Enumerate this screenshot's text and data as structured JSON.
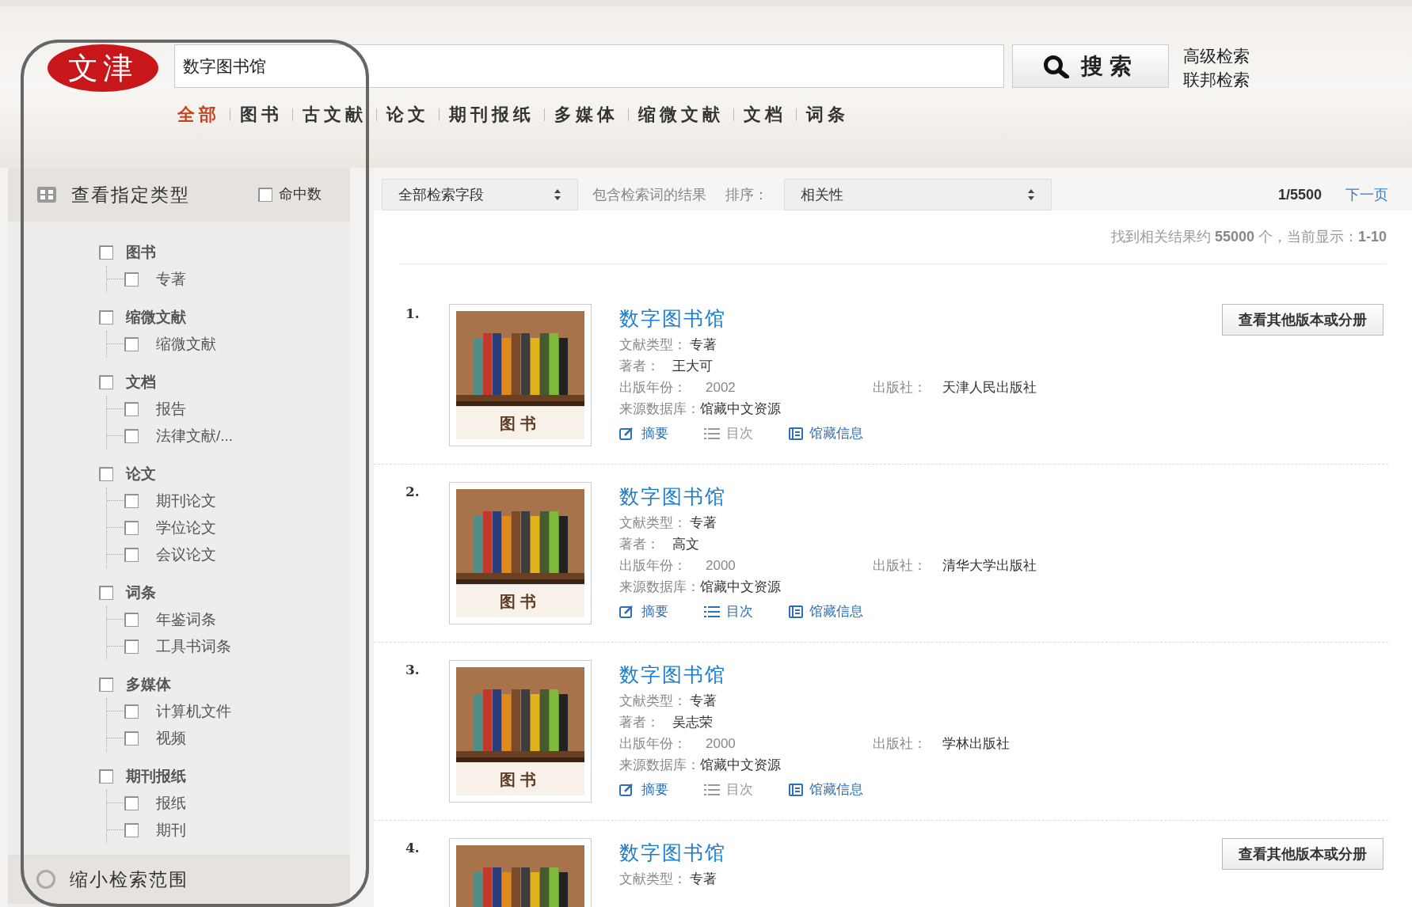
{
  "logo": {
    "text": "文津"
  },
  "search": {
    "value": "数字图书馆",
    "button": "搜索",
    "links": [
      "高级检索",
      "联邦检索"
    ]
  },
  "tabs": [
    {
      "label": "全部",
      "selected": true
    },
    {
      "label": "图书",
      "selected": false
    },
    {
      "label": "古文献",
      "selected": false
    },
    {
      "label": "论文",
      "selected": false
    },
    {
      "label": "期刊报纸",
      "selected": false
    },
    {
      "label": "多媒体",
      "selected": false
    },
    {
      "label": "缩微文献",
      "selected": false
    },
    {
      "label": "文档",
      "selected": false
    },
    {
      "label": "词条",
      "selected": false
    }
  ],
  "sidebar": {
    "title": "查看指定类型",
    "hit_count": {
      "label": "命中数",
      "checked": false
    },
    "items": [
      {
        "label": "图书",
        "checked": false,
        "children": [
          {
            "label": "专著",
            "checked": false
          }
        ]
      },
      {
        "label": "缩微文献",
        "checked": false,
        "children": [
          {
            "label": "缩微文献",
            "checked": false
          }
        ]
      },
      {
        "label": "文档",
        "checked": false,
        "children": [
          {
            "label": "报告",
            "checked": false
          },
          {
            "label": "法律文献/...",
            "checked": false
          }
        ]
      },
      {
        "label": "论文",
        "checked": false,
        "children": [
          {
            "label": "期刊论文",
            "checked": false
          },
          {
            "label": "学位论文",
            "checked": false
          },
          {
            "label": "会议论文",
            "checked": false
          }
        ]
      },
      {
        "label": "词条",
        "checked": false,
        "children": [
          {
            "label": "年鉴词条",
            "checked": false
          },
          {
            "label": "工具书词条",
            "checked": false
          }
        ]
      },
      {
        "label": "多媒体",
        "checked": false,
        "children": [
          {
            "label": "计算机文件",
            "checked": false
          },
          {
            "label": "视频",
            "checked": false
          }
        ]
      },
      {
        "label": "期刊报纸",
        "checked": false,
        "children": [
          {
            "label": "报纸",
            "checked": false
          },
          {
            "label": "期刊",
            "checked": false
          }
        ]
      }
    ],
    "narrow": {
      "label": "缩小检索范围",
      "selected": false
    }
  },
  "toolbar": {
    "field_select": "全部检索字段",
    "within_label": "包含检索词的结果",
    "sort_label": "排序：",
    "sort_select": "相关性",
    "page": "1/5500",
    "next": "下一页"
  },
  "summary": {
    "prefix": "找到相关结果约",
    "count": "55000",
    "middle": "个，当前显示：",
    "range": "1-10"
  },
  "results": [
    {
      "number": "1.",
      "cover_label": "图书",
      "title": "数字图书馆",
      "type_label": "文献类型：",
      "type": "专著",
      "author_label": "著者：",
      "author": "王大可",
      "year_label": "出版年份：",
      "year": "2002",
      "publisher_label": "出版社：",
      "publisher": "天津人民出版社",
      "source_label": "来源数据库：",
      "source": "馆藏中文资源",
      "actions": [
        {
          "label": "摘要",
          "kind": "abstract",
          "disabled": false
        },
        {
          "label": "目次",
          "kind": "toc",
          "disabled": true
        },
        {
          "label": "馆藏信息",
          "kind": "holdings",
          "disabled": false
        }
      ],
      "versions_button": "查看其他版本或分册"
    },
    {
      "number": "2.",
      "cover_label": "图书",
      "title": "数字图书馆",
      "type_label": "文献类型：",
      "type": "专著",
      "author_label": "著者：",
      "author": "高文",
      "year_label": "出版年份：",
      "year": "2000",
      "publisher_label": "出版社：",
      "publisher": "清华大学出版社",
      "source_label": "来源数据库：",
      "source": "馆藏中文资源",
      "actions": [
        {
          "label": "摘要",
          "kind": "abstract",
          "disabled": false
        },
        {
          "label": "目次",
          "kind": "toc",
          "disabled": false
        },
        {
          "label": "馆藏信息",
          "kind": "holdings",
          "disabled": false
        }
      ]
    },
    {
      "number": "3.",
      "cover_label": "图书",
      "title": "数字图书馆",
      "type_label": "文献类型：",
      "type": "专著",
      "author_label": "著者：",
      "author": "吴志荣",
      "year_label": "出版年份：",
      "year": "2000",
      "publisher_label": "出版社：",
      "publisher": "学林出版社",
      "source_label": "来源数据库：",
      "source": "馆藏中文资源",
      "actions": [
        {
          "label": "摘要",
          "kind": "abstract",
          "disabled": false
        },
        {
          "label": "目次",
          "kind": "toc",
          "disabled": true
        },
        {
          "label": "馆藏信息",
          "kind": "holdings",
          "disabled": false
        }
      ]
    },
    {
      "number": "4.",
      "title": "数字图书馆",
      "type_label": "文献类型：",
      "type": "专著",
      "versions_button": "查看其他版本或分册"
    }
  ]
}
